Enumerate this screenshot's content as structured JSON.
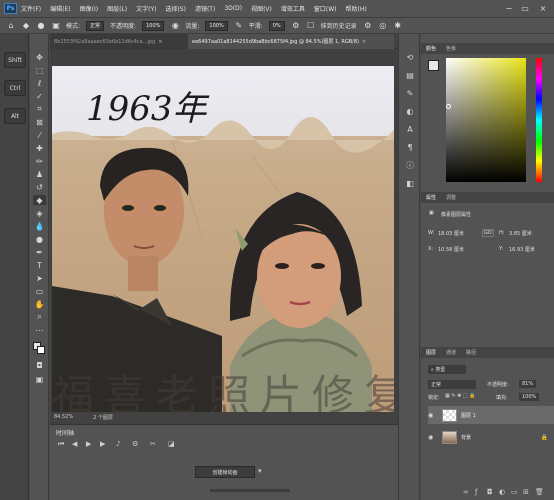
{
  "app": {
    "logo": "Ps"
  },
  "menu": [
    "文件(F)",
    "编辑(E)",
    "图像(I)",
    "图层(L)",
    "文字(Y)",
    "选择(S)",
    "滤镜(T)",
    "3D(D)",
    "视图(V)",
    "增效工具",
    "窗口(W)",
    "帮助(H)"
  ],
  "options": {
    "mode_label": "模式:",
    "mode_value": "正常",
    "opacity_label": "不透明度:",
    "opacity_value": "100%",
    "flow_label": "流量:",
    "flow_value": "100%",
    "smooth_label": "平滑:",
    "smooth_value": "0%",
    "history_label": "抹到历史记录"
  },
  "keys": [
    "Shift",
    "Ctrl",
    "Alt"
  ],
  "tabs": {
    "inactive": "8b2553f92a8aaaec63e6b12d6c4ca...jpg",
    "active": "ee6497aa01a8144255d9ba8bc6875f4.jpg @ 84.5%(图层 1, RGB/8)"
  },
  "photo": {
    "handwriting": "1963年",
    "watermark": "福喜老照片修复"
  },
  "status": {
    "zoom": "84.52%",
    "info": "2 个图层"
  },
  "timeline": {
    "title": "时间轴",
    "create_button": "创建帧动画"
  },
  "panels": {
    "color_tabs": [
      "颜色",
      "色板"
    ],
    "props_tabs": [
      "属性",
      "调整"
    ],
    "props_title": "像素图层属性",
    "w_label": "W:",
    "w_value": "18.03 厘米",
    "h_label": "H:",
    "h_value": "3.85 厘米",
    "go_label": "GO",
    "x_label": "X:",
    "x_value": "10.58 厘米",
    "y_label": "Y:",
    "y_value": "16.93 厘米",
    "layers_tabs": [
      "图层",
      "通道",
      "路径"
    ],
    "kind_label": "类型",
    "blend_value": "正常",
    "opacity_label": "不透明度:",
    "opacity_value": "81%",
    "lock_label": "锁定:",
    "fill_label": "填充:",
    "fill_value": "100%",
    "layers": [
      {
        "name": "图层 1"
      },
      {
        "name": "背景"
      }
    ]
  }
}
